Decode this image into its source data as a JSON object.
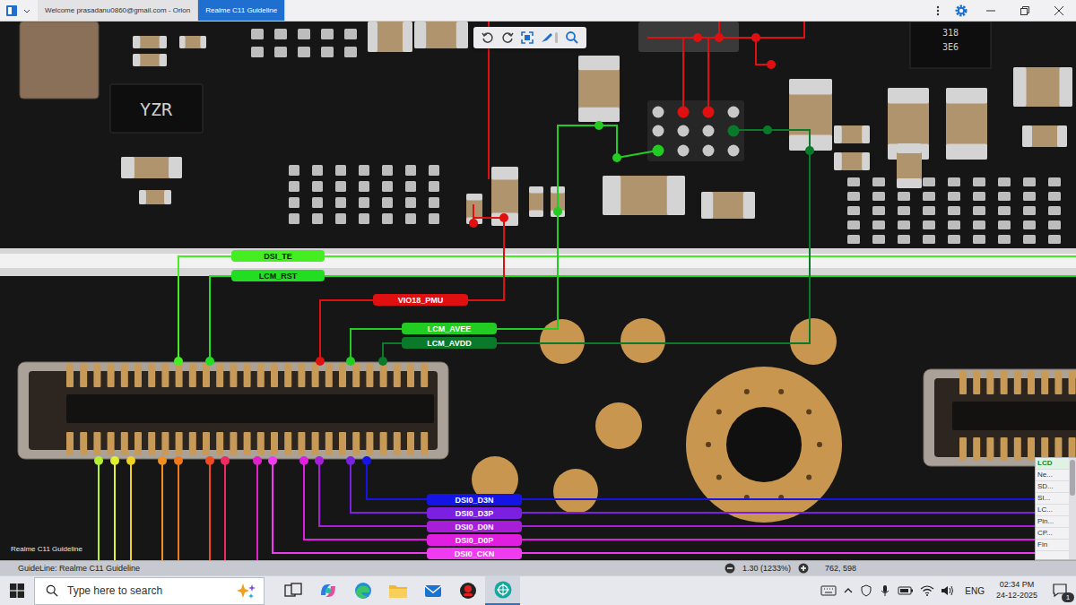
{
  "window": {
    "tabs": [
      {
        "label": "Welcome prasadanu0860@gmail.com - Orion",
        "selected": false
      },
      {
        "label": "Realme C11 Guideline",
        "selected": true
      }
    ]
  },
  "board": {
    "chip_labels": [
      "YZR",
      "318",
      "3E6"
    ],
    "caption": "Realme C11 Guideline",
    "nets": [
      {
        "label": "DSI_TE",
        "color": "#44ee22"
      },
      {
        "label": "LCM_RST",
        "color": "#22dd22"
      },
      {
        "label": "VIO18_PMU",
        "color": "#e01010"
      },
      {
        "label": "LCM_AVEE",
        "color": "#22cc22"
      },
      {
        "label": "LCM_AVDD",
        "color": "#0a7a2a"
      },
      {
        "label": "DSI0_D3N",
        "color": "#1414e6"
      },
      {
        "label": "DSI0_D3P",
        "color": "#7b1fe0"
      },
      {
        "label": "DSI0_D0N",
        "color": "#a61ed8"
      },
      {
        "label": "DSI0_D0P",
        "color": "#e01ee0"
      },
      {
        "label": "DSI0_CKN",
        "color": "#f03cf0"
      }
    ],
    "stubs": [
      {
        "color": "#b4f032"
      },
      {
        "color": "#e0f030"
      },
      {
        "color": "#f0d020"
      },
      {
        "color": "#f09020"
      },
      {
        "color": "#f07818"
      },
      {
        "color": "#f04a20"
      },
      {
        "color": "#f02a60"
      },
      {
        "color": "#e020c8"
      }
    ]
  },
  "legend": [
    {
      "label": "LCD",
      "selected": true
    },
    {
      "label": "Ne...",
      "selected": false
    },
    {
      "label": "SD...",
      "selected": false
    },
    {
      "label": "SI...",
      "selected": false
    },
    {
      "label": "LC...",
      "selected": false
    },
    {
      "label": "Pin...",
      "selected": false
    },
    {
      "label": "CP...",
      "selected": false
    },
    {
      "label": "Fin",
      "selected": false
    }
  ],
  "status_bar": {
    "guideline": "GuideLine: Realme C11 Guideline",
    "zoom": "1.30 (1233%)",
    "coords": "762, 598"
  },
  "taskbar": {
    "search_placeholder": "Type here to search",
    "apps": [
      {
        "kind": "task-view",
        "active": false
      },
      {
        "kind": "copilot",
        "active": false
      },
      {
        "kind": "edge",
        "active": false
      },
      {
        "kind": "explorer",
        "active": false
      },
      {
        "kind": "mail",
        "active": false
      },
      {
        "kind": "app-red",
        "active": false
      },
      {
        "kind": "orion",
        "active": true
      }
    ],
    "language": "ENG",
    "time": "02:34 PM",
    "date": "24-12-2025",
    "notifications": "1"
  }
}
